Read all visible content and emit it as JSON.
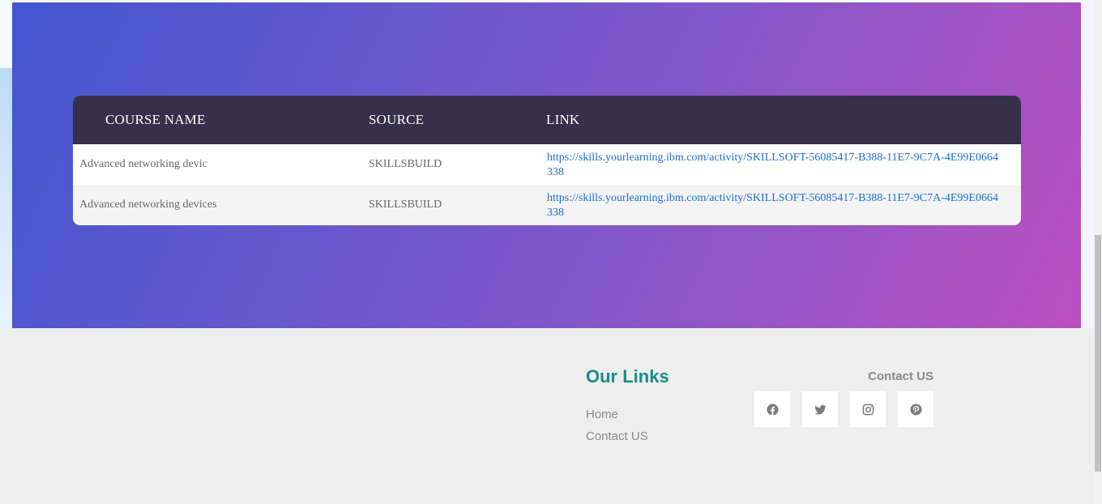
{
  "table": {
    "headers": {
      "course_name": "COURSE NAME",
      "source": "SOURCE",
      "link": "LINK"
    },
    "rows": [
      {
        "course_name": "Advanced networking devic",
        "source": "SKILLSBUILD",
        "link": "https://skills.yourlearning.ibm.com/activity/SKILLSOFT-56085417-B388-11E7-9C7A-4E99E0664338"
      },
      {
        "course_name": "Advanced networking devices",
        "source": "SKILLSBUILD",
        "link": "https://skills.yourlearning.ibm.com/activity/SKILLSOFT-56085417-B388-11E7-9C7A-4E99E0664338"
      }
    ]
  },
  "footer": {
    "links_title": "Our Links",
    "links": [
      "Home",
      "Contact US"
    ],
    "contact_title": "Contact US",
    "social_icons": [
      "facebook-icon",
      "twitter-icon",
      "instagram-icon",
      "pinterest-icon"
    ]
  },
  "colors": {
    "table_header_bg": "#37304b",
    "link": "#1a6fd6",
    "footer_title": "#178d8b",
    "hero_gradient_start": "#4257d1",
    "hero_gradient_end": "#bb4fc0"
  }
}
